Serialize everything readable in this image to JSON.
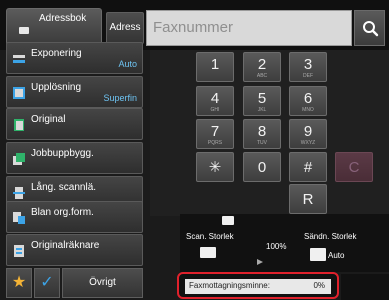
{
  "topbar": {
    "addressbook_label": "Adressbok",
    "address_label": "Adress",
    "fax_placeholder": "Faxnummer",
    "search_icon": "search-icon"
  },
  "sidebar": {
    "items": [
      {
        "label": "Exponering",
        "value": "Auto",
        "icon": "exposure-icon"
      },
      {
        "label": "Upplösning",
        "value": "Superfin",
        "icon": "resolution-icon"
      },
      {
        "label": "Original",
        "value": "",
        "icon": "original-icon"
      },
      {
        "label": "Jobbuppbygg.",
        "value": "",
        "icon": "job-build-icon"
      },
      {
        "label": "Lång. scannlä.",
        "value": "",
        "icon": "long-scan-icon"
      },
      {
        "label": "Blan org.form.",
        "value": "",
        "icon": "mixed-original-icon"
      },
      {
        "label": "Originalräknare",
        "value": "",
        "icon": "original-counter-icon"
      }
    ],
    "bottom": {
      "star_icon": "star-icon",
      "check_icon": "check-icon",
      "ovrigt_label": "Övrigt"
    }
  },
  "keypad": {
    "keys": [
      {
        "d": "1",
        "s": ""
      },
      {
        "d": "2",
        "s": "ABC"
      },
      {
        "d": "3",
        "s": "DEF"
      },
      {
        "d": "4",
        "s": "GHI"
      },
      {
        "d": "5",
        "s": "JKL"
      },
      {
        "d": "6",
        "s": "MNO"
      },
      {
        "d": "7",
        "s": "PQRS"
      },
      {
        "d": "8",
        "s": "TUV"
      },
      {
        "d": "9",
        "s": "WXYZ"
      },
      {
        "d": "✳",
        "s": ""
      },
      {
        "d": "0",
        "s": ""
      },
      {
        "d": "#",
        "s": ""
      },
      {
        "d": "C",
        "s": ""
      },
      {
        "d": "R",
        "s": ""
      }
    ]
  },
  "size": {
    "scan_label": "Scan. Storlek",
    "zoom": "100%",
    "send_label": "Sändn. Storlek",
    "send_value": "Auto"
  },
  "memory": {
    "label": "Faxmottagningsminne:",
    "percent": "0%"
  },
  "colors": {
    "accent_blue": "#6ec3f2",
    "highlight_red": "#e0212c",
    "star": "#f3b336"
  }
}
